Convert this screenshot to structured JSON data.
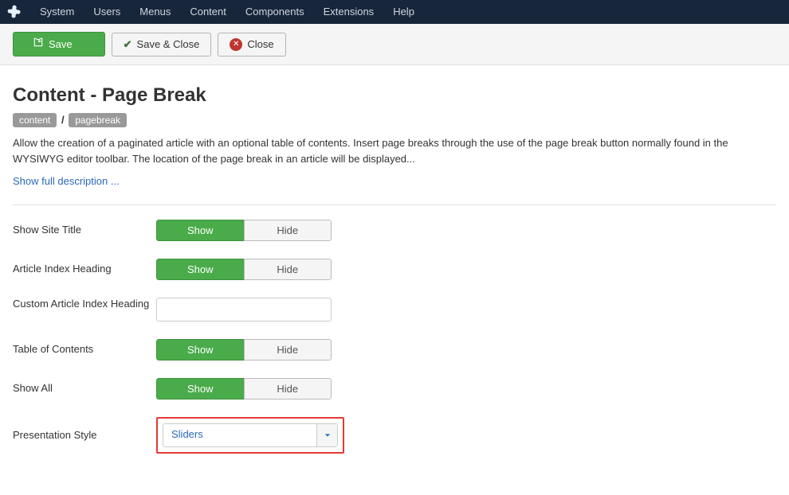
{
  "nav": {
    "items": [
      "System",
      "Users",
      "Menus",
      "Content",
      "Components",
      "Extensions",
      "Help"
    ]
  },
  "toolbar": {
    "save": "Save",
    "save_close": "Save & Close",
    "close": "Close"
  },
  "page": {
    "title": "Content - Page Break",
    "tag1": "content",
    "tag_sep": "/",
    "tag2": "pagebreak",
    "description": "Allow the creation of a paginated article with an optional table of contents. Insert page breaks through the use of the page break button normally found in the WYSIWYG editor toolbar. The location of the page break in an article will be displayed...",
    "show_full": "Show full description ..."
  },
  "form": {
    "show_opt": "Show",
    "hide_opt": "Hide",
    "site_title": {
      "label": "Show Site Title"
    },
    "article_heading": {
      "label": "Article Index Heading"
    },
    "custom_heading": {
      "label": "Custom Article Index Heading",
      "value": ""
    },
    "toc": {
      "label": "Table of Contents"
    },
    "show_all": {
      "label": "Show All"
    },
    "presentation": {
      "label": "Presentation Style",
      "value": "Sliders"
    }
  }
}
